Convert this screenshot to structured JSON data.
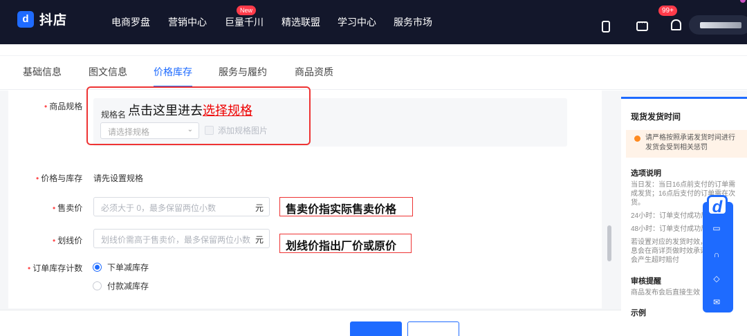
{
  "header": {
    "brand_logo_text": "d",
    "brand_name": "抖店",
    "nav": [
      "电商罗盘",
      "营销中心",
      "巨量千川",
      "精选联盟",
      "学习中心",
      "服务市场"
    ],
    "new_badge": "New",
    "notification_count": "99+"
  },
  "tabs": [
    "基础信息",
    "图文信息",
    "价格库存",
    "服务与履约",
    "商品资质"
  ],
  "active_tab": "价格库存",
  "form": {
    "spec_label": "商品规格",
    "spec_name_label": "规格名",
    "spec_select_placeholder": "请选择规格",
    "add_spec_image_label": "添加规格图片",
    "price_stock_label": "价格与库存",
    "price_stock_hint": "请先设置规格",
    "sale_price_label": "售卖价",
    "sale_price_placeholder": "必须大于 0，最多保留两位小数",
    "unit": "元",
    "strike_price_label": "划线价",
    "strike_price_placeholder": "划线价需高于售卖价，最多保留两位小数",
    "inventory_label": "订单库存计数",
    "inventory_options": [
      "下单减库存",
      "付款减库存"
    ],
    "inventory_selected": "下单减库存"
  },
  "annotations": {
    "spec_instruction_prefix": "点击这里进去",
    "spec_instruction_link": "选择规格",
    "sale_price_note": "售卖价指实际售卖价格",
    "strike_price_note": "划线价指出厂价或原价"
  },
  "right_panel": {
    "title": "现货发货时间",
    "warning_lines": [
      "请严格按照承诺发货时间进行",
      "发货会受到相关惩罚"
    ],
    "options_title": "选项说明",
    "options_lines": [
      "当日发：当日16点前支付的订单需",
      "成发货；16点后支付的订单需在次",
      "货。",
      "24小时：订单支付成功后24小",
      "48小时：订单支付成功后48小",
      "若设置对应的发货时效，下",
      "息会在商详页做时效承诺，如",
      "会产生超时赔付"
    ],
    "review_title": "审核提醒",
    "review_text": "商品发布会后直接生效",
    "example_title": "示例"
  },
  "floating_toolbar": {
    "logo_text": "d",
    "icons": [
      "book-icon",
      "headset-icon",
      "shield-icon",
      "mail-icon"
    ]
  },
  "colors": {
    "header_bg": "#13172b",
    "accent": "#1e6bff",
    "annotation_red": "#e33",
    "required": "#ff4d4f"
  }
}
